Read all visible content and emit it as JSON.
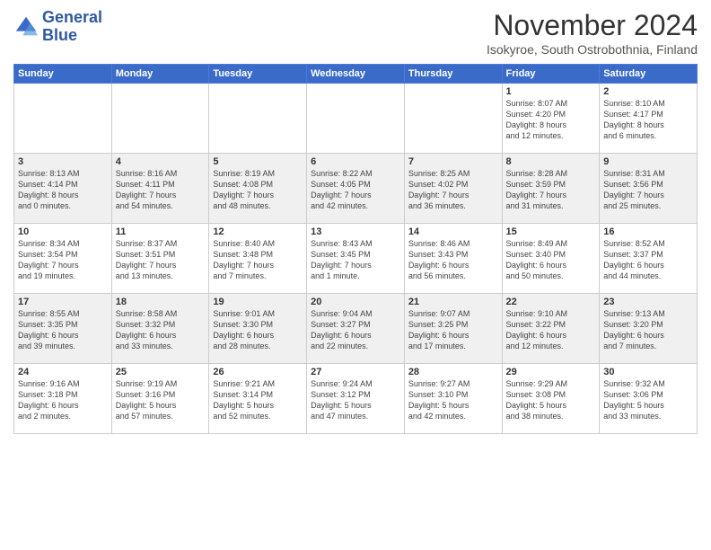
{
  "logo": {
    "line1": "General",
    "line2": "Blue"
  },
  "title": "November 2024",
  "subtitle": "Isokyroe, South Ostrobothnia, Finland",
  "weekdays": [
    "Sunday",
    "Monday",
    "Tuesday",
    "Wednesday",
    "Thursday",
    "Friday",
    "Saturday"
  ],
  "weeks": [
    [
      {
        "day": "",
        "info": ""
      },
      {
        "day": "",
        "info": ""
      },
      {
        "day": "",
        "info": ""
      },
      {
        "day": "",
        "info": ""
      },
      {
        "day": "",
        "info": ""
      },
      {
        "day": "1",
        "info": "Sunrise: 8:07 AM\nSunset: 4:20 PM\nDaylight: 8 hours\nand 12 minutes."
      },
      {
        "day": "2",
        "info": "Sunrise: 8:10 AM\nSunset: 4:17 PM\nDaylight: 8 hours\nand 6 minutes."
      }
    ],
    [
      {
        "day": "3",
        "info": "Sunrise: 8:13 AM\nSunset: 4:14 PM\nDaylight: 8 hours\nand 0 minutes."
      },
      {
        "day": "4",
        "info": "Sunrise: 8:16 AM\nSunset: 4:11 PM\nDaylight: 7 hours\nand 54 minutes."
      },
      {
        "day": "5",
        "info": "Sunrise: 8:19 AM\nSunset: 4:08 PM\nDaylight: 7 hours\nand 48 minutes."
      },
      {
        "day": "6",
        "info": "Sunrise: 8:22 AM\nSunset: 4:05 PM\nDaylight: 7 hours\nand 42 minutes."
      },
      {
        "day": "7",
        "info": "Sunrise: 8:25 AM\nSunset: 4:02 PM\nDaylight: 7 hours\nand 36 minutes."
      },
      {
        "day": "8",
        "info": "Sunrise: 8:28 AM\nSunset: 3:59 PM\nDaylight: 7 hours\nand 31 minutes."
      },
      {
        "day": "9",
        "info": "Sunrise: 8:31 AM\nSunset: 3:56 PM\nDaylight: 7 hours\nand 25 minutes."
      }
    ],
    [
      {
        "day": "10",
        "info": "Sunrise: 8:34 AM\nSunset: 3:54 PM\nDaylight: 7 hours\nand 19 minutes."
      },
      {
        "day": "11",
        "info": "Sunrise: 8:37 AM\nSunset: 3:51 PM\nDaylight: 7 hours\nand 13 minutes."
      },
      {
        "day": "12",
        "info": "Sunrise: 8:40 AM\nSunset: 3:48 PM\nDaylight: 7 hours\nand 7 minutes."
      },
      {
        "day": "13",
        "info": "Sunrise: 8:43 AM\nSunset: 3:45 PM\nDaylight: 7 hours\nand 1 minute."
      },
      {
        "day": "14",
        "info": "Sunrise: 8:46 AM\nSunset: 3:43 PM\nDaylight: 6 hours\nand 56 minutes."
      },
      {
        "day": "15",
        "info": "Sunrise: 8:49 AM\nSunset: 3:40 PM\nDaylight: 6 hours\nand 50 minutes."
      },
      {
        "day": "16",
        "info": "Sunrise: 8:52 AM\nSunset: 3:37 PM\nDaylight: 6 hours\nand 44 minutes."
      }
    ],
    [
      {
        "day": "17",
        "info": "Sunrise: 8:55 AM\nSunset: 3:35 PM\nDaylight: 6 hours\nand 39 minutes."
      },
      {
        "day": "18",
        "info": "Sunrise: 8:58 AM\nSunset: 3:32 PM\nDaylight: 6 hours\nand 33 minutes."
      },
      {
        "day": "19",
        "info": "Sunrise: 9:01 AM\nSunset: 3:30 PM\nDaylight: 6 hours\nand 28 minutes."
      },
      {
        "day": "20",
        "info": "Sunrise: 9:04 AM\nSunset: 3:27 PM\nDaylight: 6 hours\nand 22 minutes."
      },
      {
        "day": "21",
        "info": "Sunrise: 9:07 AM\nSunset: 3:25 PM\nDaylight: 6 hours\nand 17 minutes."
      },
      {
        "day": "22",
        "info": "Sunrise: 9:10 AM\nSunset: 3:22 PM\nDaylight: 6 hours\nand 12 minutes."
      },
      {
        "day": "23",
        "info": "Sunrise: 9:13 AM\nSunset: 3:20 PM\nDaylight: 6 hours\nand 7 minutes."
      }
    ],
    [
      {
        "day": "24",
        "info": "Sunrise: 9:16 AM\nSunset: 3:18 PM\nDaylight: 6 hours\nand 2 minutes."
      },
      {
        "day": "25",
        "info": "Sunrise: 9:19 AM\nSunset: 3:16 PM\nDaylight: 5 hours\nand 57 minutes."
      },
      {
        "day": "26",
        "info": "Sunrise: 9:21 AM\nSunset: 3:14 PM\nDaylight: 5 hours\nand 52 minutes."
      },
      {
        "day": "27",
        "info": "Sunrise: 9:24 AM\nSunset: 3:12 PM\nDaylight: 5 hours\nand 47 minutes."
      },
      {
        "day": "28",
        "info": "Sunrise: 9:27 AM\nSunset: 3:10 PM\nDaylight: 5 hours\nand 42 minutes."
      },
      {
        "day": "29",
        "info": "Sunrise: 9:29 AM\nSunset: 3:08 PM\nDaylight: 5 hours\nand 38 minutes."
      },
      {
        "day": "30",
        "info": "Sunrise: 9:32 AM\nSunset: 3:06 PM\nDaylight: 5 hours\nand 33 minutes."
      }
    ]
  ]
}
